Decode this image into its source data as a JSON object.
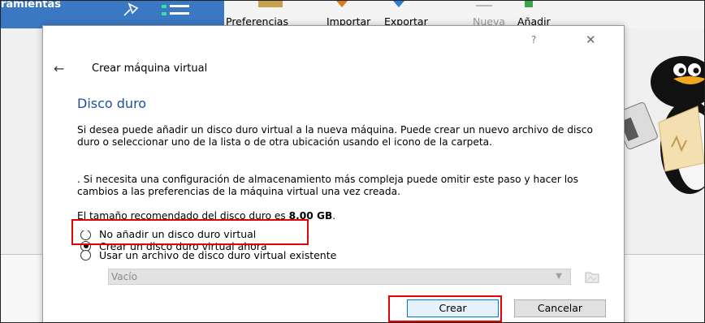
{
  "background_window": {
    "left_panel_title": "ramientas",
    "toolbar": {
      "preferences": "Preferencias",
      "import": "Importar",
      "export": "Exportar",
      "new": "Nueva",
      "add": "Añadir"
    }
  },
  "dialog": {
    "help": "?",
    "close": "✕",
    "title": "Crear máquina virtual",
    "section_title": "Disco duro",
    "paragraph1": "Si desea puede añadir un disco duro virtual a la nueva máquina. Puede crear un nuevo archivo de disco duro o seleccionar uno de la lista o de otra ubicación usando el icono de la carpeta.",
    "paragraph2": ". Si necesita una configuración de almacenamiento más compleja puede omitir este paso y hacer los cambios a las preferencias de la máquina virtual una vez creada.",
    "recommended_prefix": "El tamaño recomendado del disco duro es ",
    "recommended_size": "8.00 GB",
    "recommended_suffix": ".",
    "options": [
      {
        "label": "No añadir un disco duro virtual",
        "checked": false
      },
      {
        "label": "Crear un disco duro virtual ahora",
        "checked": true
      },
      {
        "label": "Usar un archivo de disco duro virtual existente",
        "checked": false
      }
    ],
    "disk_select_value": "Vacío",
    "buttons": {
      "create": "Crear",
      "cancel": "Cancelar"
    }
  },
  "colors": {
    "section_title": "#1f4fa0",
    "highlight": "#e60000",
    "left_bar": "#3a78c3"
  }
}
